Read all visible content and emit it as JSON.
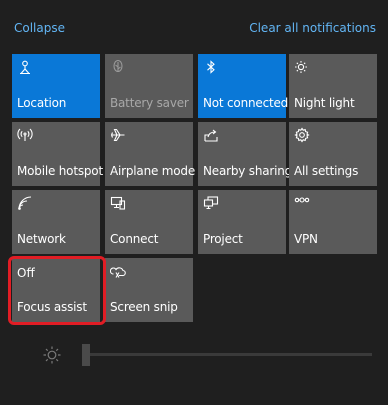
{
  "header": {
    "collapse_label": "Collapse",
    "clear_label": "Clear all notifications"
  },
  "colors": {
    "accent_blue": "#0a78d7",
    "tile_gray": "#5a5a5a",
    "link_blue": "#62b5f4",
    "highlight_red": "#e11d25",
    "background": "#1f1f1f"
  },
  "tiles": [
    {
      "label": "Location",
      "icon": "location-icon",
      "state": "on"
    },
    {
      "label": "Battery saver",
      "icon": "battery-saver-icon",
      "state": "disabled"
    },
    {
      "label": "Not connected",
      "icon": "bluetooth-icon",
      "state": "on"
    },
    {
      "label": "Night light",
      "icon": "night-light-icon",
      "state": "off"
    },
    {
      "label": "Mobile hotspot",
      "icon": "mobile-hotspot-icon",
      "state": "off"
    },
    {
      "label": "Airplane mode",
      "icon": "airplane-icon",
      "state": "off"
    },
    {
      "label": "Nearby sharing",
      "icon": "nearby-sharing-icon",
      "state": "off"
    },
    {
      "label": "All settings",
      "icon": "gear-icon",
      "state": "off"
    },
    {
      "label": "Network",
      "icon": "network-icon",
      "state": "off"
    },
    {
      "label": "Connect",
      "icon": "connect-icon",
      "state": "off"
    },
    {
      "label": "Project",
      "icon": "project-icon",
      "state": "off"
    },
    {
      "label": "VPN",
      "icon": "vpn-icon",
      "state": "off"
    },
    {
      "label": "Focus assist",
      "status": "Off",
      "state": "off"
    },
    {
      "label": "Screen snip",
      "icon": "screen-snip-icon",
      "state": "off"
    }
  ],
  "brightness": {
    "icon": "brightness-icon",
    "level_percent": 0
  }
}
